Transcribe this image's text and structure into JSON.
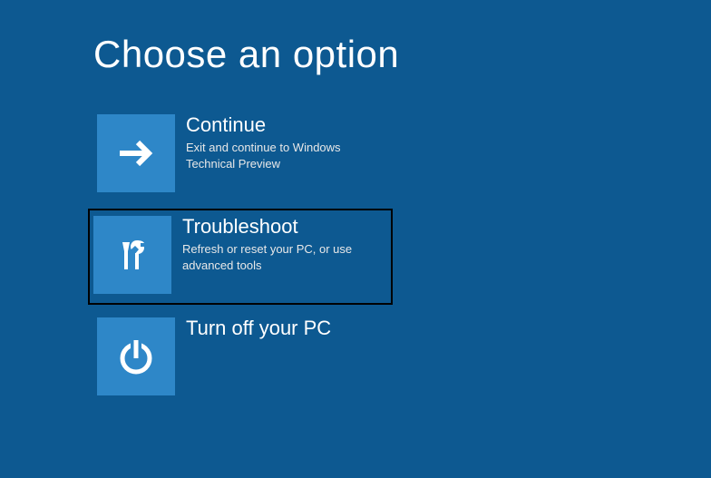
{
  "page": {
    "title": "Choose an option"
  },
  "options": [
    {
      "title": "Continue",
      "description": "Exit and continue to Windows Technical Preview"
    },
    {
      "title": "Troubleshoot",
      "description": "Refresh or reset your PC, or use advanced tools"
    },
    {
      "title": "Turn off your PC",
      "description": ""
    }
  ]
}
